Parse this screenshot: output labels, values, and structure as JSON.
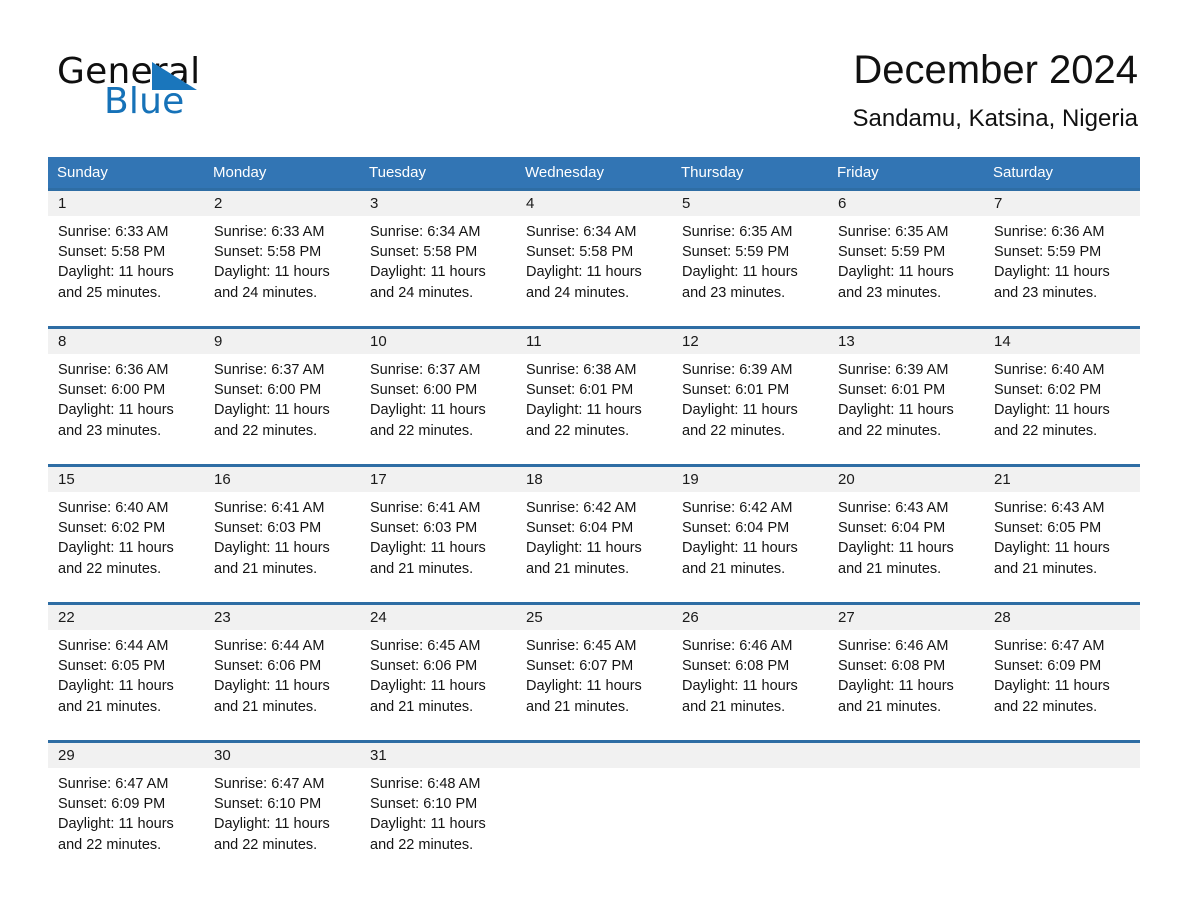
{
  "brand": {
    "name_part1": "General",
    "name_part2": "Blue",
    "accent_color": "#1a76bc"
  },
  "header": {
    "month_title": "December 2024",
    "location": "Sandamu, Katsina, Nigeria"
  },
  "theme": {
    "header_blue": "#3275b4",
    "row_divider_blue": "#2e6da4",
    "daynum_band": "#f1f1f1"
  },
  "weekdays": [
    "Sunday",
    "Monday",
    "Tuesday",
    "Wednesday",
    "Thursday",
    "Friday",
    "Saturday"
  ],
  "weeks": [
    {
      "days": [
        {
          "date": "1",
          "sunrise": "Sunrise: 6:33 AM",
          "sunset": "Sunset: 5:58 PM",
          "daylight_line1": "Daylight: 11 hours",
          "daylight_line2": "and 25 minutes."
        },
        {
          "date": "2",
          "sunrise": "Sunrise: 6:33 AM",
          "sunset": "Sunset: 5:58 PM",
          "daylight_line1": "Daylight: 11 hours",
          "daylight_line2": "and 24 minutes."
        },
        {
          "date": "3",
          "sunrise": "Sunrise: 6:34 AM",
          "sunset": "Sunset: 5:58 PM",
          "daylight_line1": "Daylight: 11 hours",
          "daylight_line2": "and 24 minutes."
        },
        {
          "date": "4",
          "sunrise": "Sunrise: 6:34 AM",
          "sunset": "Sunset: 5:58 PM",
          "daylight_line1": "Daylight: 11 hours",
          "daylight_line2": "and 24 minutes."
        },
        {
          "date": "5",
          "sunrise": "Sunrise: 6:35 AM",
          "sunset": "Sunset: 5:59 PM",
          "daylight_line1": "Daylight: 11 hours",
          "daylight_line2": "and 23 minutes."
        },
        {
          "date": "6",
          "sunrise": "Sunrise: 6:35 AM",
          "sunset": "Sunset: 5:59 PM",
          "daylight_line1": "Daylight: 11 hours",
          "daylight_line2": "and 23 minutes."
        },
        {
          "date": "7",
          "sunrise": "Sunrise: 6:36 AM",
          "sunset": "Sunset: 5:59 PM",
          "daylight_line1": "Daylight: 11 hours",
          "daylight_line2": "and 23 minutes."
        }
      ]
    },
    {
      "days": [
        {
          "date": "8",
          "sunrise": "Sunrise: 6:36 AM",
          "sunset": "Sunset: 6:00 PM",
          "daylight_line1": "Daylight: 11 hours",
          "daylight_line2": "and 23 minutes."
        },
        {
          "date": "9",
          "sunrise": "Sunrise: 6:37 AM",
          "sunset": "Sunset: 6:00 PM",
          "daylight_line1": "Daylight: 11 hours",
          "daylight_line2": "and 22 minutes."
        },
        {
          "date": "10",
          "sunrise": "Sunrise: 6:37 AM",
          "sunset": "Sunset: 6:00 PM",
          "daylight_line1": "Daylight: 11 hours",
          "daylight_line2": "and 22 minutes."
        },
        {
          "date": "11",
          "sunrise": "Sunrise: 6:38 AM",
          "sunset": "Sunset: 6:01 PM",
          "daylight_line1": "Daylight: 11 hours",
          "daylight_line2": "and 22 minutes."
        },
        {
          "date": "12",
          "sunrise": "Sunrise: 6:39 AM",
          "sunset": "Sunset: 6:01 PM",
          "daylight_line1": "Daylight: 11 hours",
          "daylight_line2": "and 22 minutes."
        },
        {
          "date": "13",
          "sunrise": "Sunrise: 6:39 AM",
          "sunset": "Sunset: 6:01 PM",
          "daylight_line1": "Daylight: 11 hours",
          "daylight_line2": "and 22 minutes."
        },
        {
          "date": "14",
          "sunrise": "Sunrise: 6:40 AM",
          "sunset": "Sunset: 6:02 PM",
          "daylight_line1": "Daylight: 11 hours",
          "daylight_line2": "and 22 minutes."
        }
      ]
    },
    {
      "days": [
        {
          "date": "15",
          "sunrise": "Sunrise: 6:40 AM",
          "sunset": "Sunset: 6:02 PM",
          "daylight_line1": "Daylight: 11 hours",
          "daylight_line2": "and 22 minutes."
        },
        {
          "date": "16",
          "sunrise": "Sunrise: 6:41 AM",
          "sunset": "Sunset: 6:03 PM",
          "daylight_line1": "Daylight: 11 hours",
          "daylight_line2": "and 21 minutes."
        },
        {
          "date": "17",
          "sunrise": "Sunrise: 6:41 AM",
          "sunset": "Sunset: 6:03 PM",
          "daylight_line1": "Daylight: 11 hours",
          "daylight_line2": "and 21 minutes."
        },
        {
          "date": "18",
          "sunrise": "Sunrise: 6:42 AM",
          "sunset": "Sunset: 6:04 PM",
          "daylight_line1": "Daylight: 11 hours",
          "daylight_line2": "and 21 minutes."
        },
        {
          "date": "19",
          "sunrise": "Sunrise: 6:42 AM",
          "sunset": "Sunset: 6:04 PM",
          "daylight_line1": "Daylight: 11 hours",
          "daylight_line2": "and 21 minutes."
        },
        {
          "date": "20",
          "sunrise": "Sunrise: 6:43 AM",
          "sunset": "Sunset: 6:04 PM",
          "daylight_line1": "Daylight: 11 hours",
          "daylight_line2": "and 21 minutes."
        },
        {
          "date": "21",
          "sunrise": "Sunrise: 6:43 AM",
          "sunset": "Sunset: 6:05 PM",
          "daylight_line1": "Daylight: 11 hours",
          "daylight_line2": "and 21 minutes."
        }
      ]
    },
    {
      "days": [
        {
          "date": "22",
          "sunrise": "Sunrise: 6:44 AM",
          "sunset": "Sunset: 6:05 PM",
          "daylight_line1": "Daylight: 11 hours",
          "daylight_line2": "and 21 minutes."
        },
        {
          "date": "23",
          "sunrise": "Sunrise: 6:44 AM",
          "sunset": "Sunset: 6:06 PM",
          "daylight_line1": "Daylight: 11 hours",
          "daylight_line2": "and 21 minutes."
        },
        {
          "date": "24",
          "sunrise": "Sunrise: 6:45 AM",
          "sunset": "Sunset: 6:06 PM",
          "daylight_line1": "Daylight: 11 hours",
          "daylight_line2": "and 21 minutes."
        },
        {
          "date": "25",
          "sunrise": "Sunrise: 6:45 AM",
          "sunset": "Sunset: 6:07 PM",
          "daylight_line1": "Daylight: 11 hours",
          "daylight_line2": "and 21 minutes."
        },
        {
          "date": "26",
          "sunrise": "Sunrise: 6:46 AM",
          "sunset": "Sunset: 6:08 PM",
          "daylight_line1": "Daylight: 11 hours",
          "daylight_line2": "and 21 minutes."
        },
        {
          "date": "27",
          "sunrise": "Sunrise: 6:46 AM",
          "sunset": "Sunset: 6:08 PM",
          "daylight_line1": "Daylight: 11 hours",
          "daylight_line2": "and 21 minutes."
        },
        {
          "date": "28",
          "sunrise": "Sunrise: 6:47 AM",
          "sunset": "Sunset: 6:09 PM",
          "daylight_line1": "Daylight: 11 hours",
          "daylight_line2": "and 22 minutes."
        }
      ]
    },
    {
      "days": [
        {
          "date": "29",
          "sunrise": "Sunrise: 6:47 AM",
          "sunset": "Sunset: 6:09 PM",
          "daylight_line1": "Daylight: 11 hours",
          "daylight_line2": "and 22 minutes."
        },
        {
          "date": "30",
          "sunrise": "Sunrise: 6:47 AM",
          "sunset": "Sunset: 6:10 PM",
          "daylight_line1": "Daylight: 11 hours",
          "daylight_line2": "and 22 minutes."
        },
        {
          "date": "31",
          "sunrise": "Sunrise: 6:48 AM",
          "sunset": "Sunset: 6:10 PM",
          "daylight_line1": "Daylight: 11 hours",
          "daylight_line2": "and 22 minutes."
        },
        {
          "date": "",
          "sunrise": "",
          "sunset": "",
          "daylight_line1": "",
          "daylight_line2": ""
        },
        {
          "date": "",
          "sunrise": "",
          "sunset": "",
          "daylight_line1": "",
          "daylight_line2": ""
        },
        {
          "date": "",
          "sunrise": "",
          "sunset": "",
          "daylight_line1": "",
          "daylight_line2": ""
        },
        {
          "date": "",
          "sunrise": "",
          "sunset": "",
          "daylight_line1": "",
          "daylight_line2": ""
        }
      ]
    }
  ]
}
